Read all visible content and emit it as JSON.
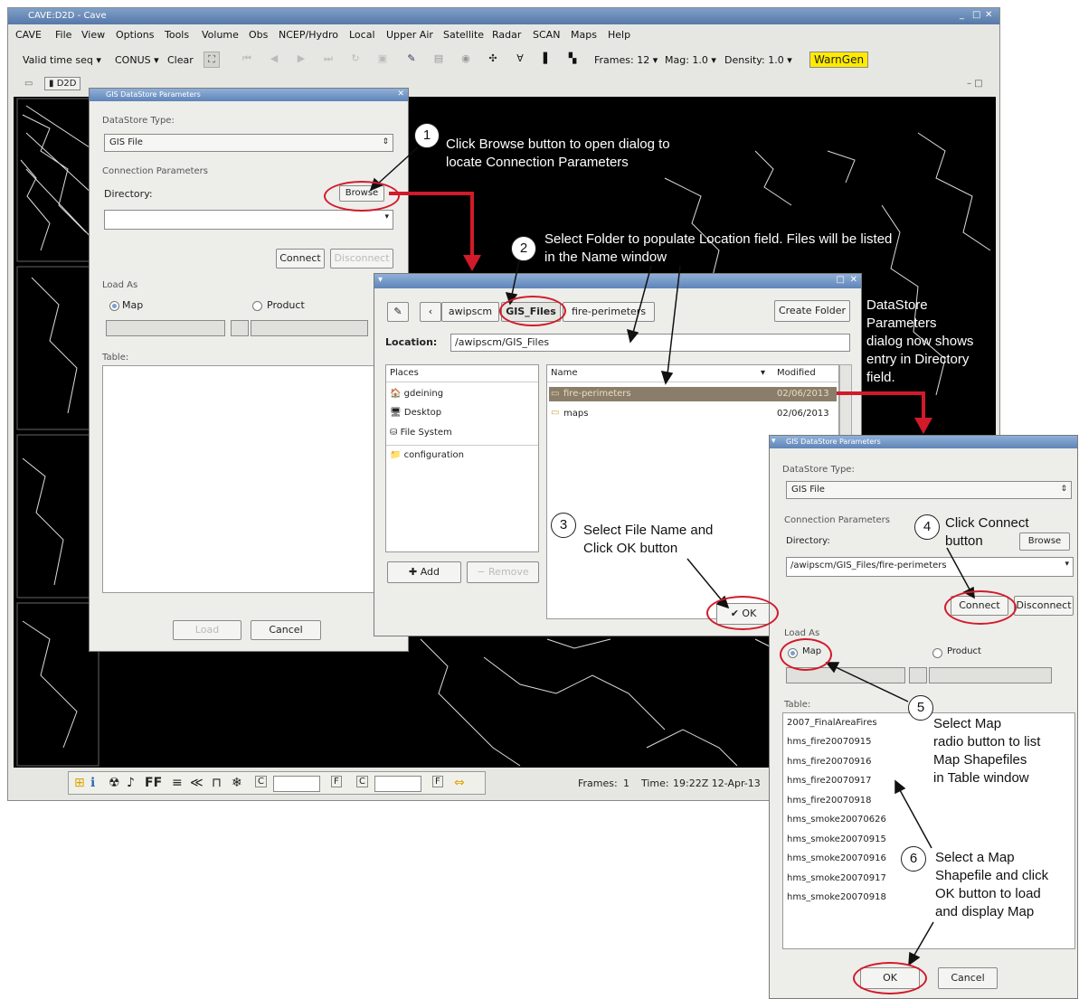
{
  "cave": {
    "window_title": "CAVE:D2D - Cave",
    "menu": [
      "CAVE",
      "File",
      "View",
      "Options",
      "Tools",
      "Volume",
      "Obs",
      "NCEP/Hydro",
      "Local",
      "Upper Air",
      "Satellite",
      "Radar",
      "SCAN",
      "Maps",
      "Help"
    ],
    "toolbar": {
      "valid_time": "Valid time seq",
      "conus": "CONUS",
      "clear": "Clear",
      "frames": "Frames: 12",
      "mag": "Mag: 1.0",
      "density": "Density: 1.0",
      "warngen": "WarnGen"
    },
    "tab": "D2D",
    "status": {
      "frames_label": "Frames:",
      "frames_value": "1",
      "time_label": "Time:",
      "time_value": "19:22Z 12-Apr-13",
      "ff": "FF",
      "c1": "C",
      "f1": "F",
      "c2": "C",
      "f2": "F"
    }
  },
  "dialog1": {
    "title": "GIS DataStore Parameters",
    "datastore_type_label": "DataStore Type:",
    "datastore_type_value": "GIS File",
    "connection_params_label": "Connection Parameters",
    "directory_label": "Directory:",
    "browse": "Browse",
    "connect": "Connect",
    "disconnect": "Disconnect",
    "load_as_label": "Load As",
    "map_label": "Map",
    "product_label": "Product",
    "table_label": "Table:",
    "ok": "Load",
    "cancel": "Cancel"
  },
  "filechooser": {
    "path_buttons": [
      "awipscm",
      "GIS_Files",
      "fire-perimeters"
    ],
    "create_folder": "Create Folder",
    "location_label": "Location:",
    "location_value": "/awipscm/GIS_Files",
    "places_header": "Places",
    "places": [
      "gdeining",
      "Desktop",
      "File System",
      "configuration"
    ],
    "name_header": "Name",
    "modified_header": "Modified",
    "files": [
      {
        "name": "fire-perimeters",
        "modified": "02/06/2013"
      },
      {
        "name": "maps",
        "modified": "02/06/2013"
      }
    ],
    "add": "Add",
    "remove": "Remove",
    "ok": "OK"
  },
  "dialog2": {
    "title": "GIS DataStore Parameters",
    "datastore_type_label": "DataStore Type:",
    "datastore_type_value": "GIS File",
    "connection_params_label": "Connection Parameters",
    "directory_label": "Directory:",
    "browse": "Browse",
    "directory_value": "/awipscm/GIS_Files/fire-perimeters",
    "connect": "Connect",
    "disconnect": "Disconnect",
    "load_as_label": "Load As",
    "map_label": "Map",
    "product_label": "Product",
    "table_label": "Table:",
    "table_rows": [
      "2007_FinalAreaFires",
      "hms_fire20070915",
      "hms_fire20070916",
      "hms_fire20070917",
      "hms_fire20070918",
      "hms_smoke20070626",
      "hms_smoke20070915",
      "hms_smoke20070916",
      "hms_smoke20070917",
      "hms_smoke20070918"
    ],
    "ok": "OK",
    "cancel": "Cancel"
  },
  "annotations": {
    "step1": {
      "num": "1",
      "line1": "Click Browse button to open dialog to",
      "line2": "locate Connection Parameters"
    },
    "step2": {
      "num": "2",
      "line1": "Select Folder to populate Location field. Files will be listed",
      "line2": "in the Name window"
    },
    "step3": {
      "num": "3",
      "line1": "Select File Name and",
      "line2": "Click OK button"
    },
    "step4": {
      "num": "4",
      "line1": "Click Connect",
      "line2": "button"
    },
    "step5": {
      "num": "5",
      "line1": "Select Map",
      "line2": "radio button to list",
      "line3": "Map Shapefiles",
      "line4": "in Table window"
    },
    "step6": {
      "num": "6",
      "line1": "Select a Map",
      "line2": "Shapefile and click",
      "line3": "OK button to load",
      "line4": "and display Map"
    },
    "note": {
      "line1": "DataStore",
      "line2": "Parameters",
      "line3": "dialog now shows",
      "line4": "entry in Directory",
      "line5": "field."
    }
  },
  "colors": {
    "highlight": "#d11a2a",
    "warngen": "#ffea00",
    "selection": "#8a7e6a"
  }
}
